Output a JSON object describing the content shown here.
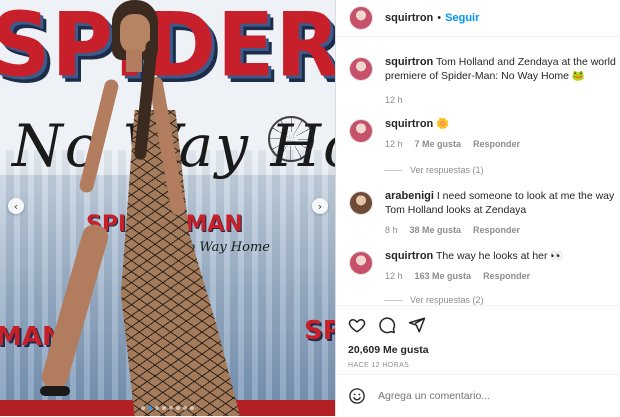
{
  "post": {
    "username": "squirtron",
    "follow_label": "Seguir",
    "separator": "•",
    "caption_user": "squirtron",
    "caption_text": "Tom Holland and Zendaya at the world premiere of Spider-Man: No Way Home 🐸",
    "caption_time": "12 h",
    "likes": "20,609 Me gusta",
    "time_ago": "HACE 12 HORAS",
    "add_comment_placeholder": "Agrega un comentario..."
  },
  "media": {
    "logo_top": "SPIDER-MAN",
    "logo_script": "No Way Home",
    "logo_small": "SPIDER-MAN",
    "logo_small_sub": "No Way Home",
    "logo_corner_left": "MAN",
    "logo_corner_right": "SPIDE",
    "carousel_dots": 8,
    "carousel_active": 1,
    "prev_label": "‹",
    "next_label": "›"
  },
  "comments": [
    {
      "user": "squirtron",
      "text": "🌼",
      "time": "12 h",
      "likes": "7 Me gusta",
      "reply": "Responder",
      "view_replies": "Ver respuestas (1)"
    },
    {
      "user": "arabenigi",
      "text": "I need someone to look at me the way Tom Holland looks at Zendaya",
      "time": "8 h",
      "likes": "38 Me gusta",
      "reply": "Responder"
    },
    {
      "user": "squirtron",
      "text": "The way he looks at her 👀",
      "time": "12 h",
      "likes": "163 Me gusta",
      "reply": "Responder",
      "view_replies": "Ver respuestas (2)"
    }
  ],
  "icons": [
    "heart-icon",
    "comment-icon",
    "share-icon",
    "smile-icon",
    "chevron-left-icon",
    "chevron-right-icon"
  ],
  "colors": {
    "link": "#0095f6",
    "muted": "#8e8e8e",
    "text": "#262626",
    "accent_red": "#c8202b"
  }
}
